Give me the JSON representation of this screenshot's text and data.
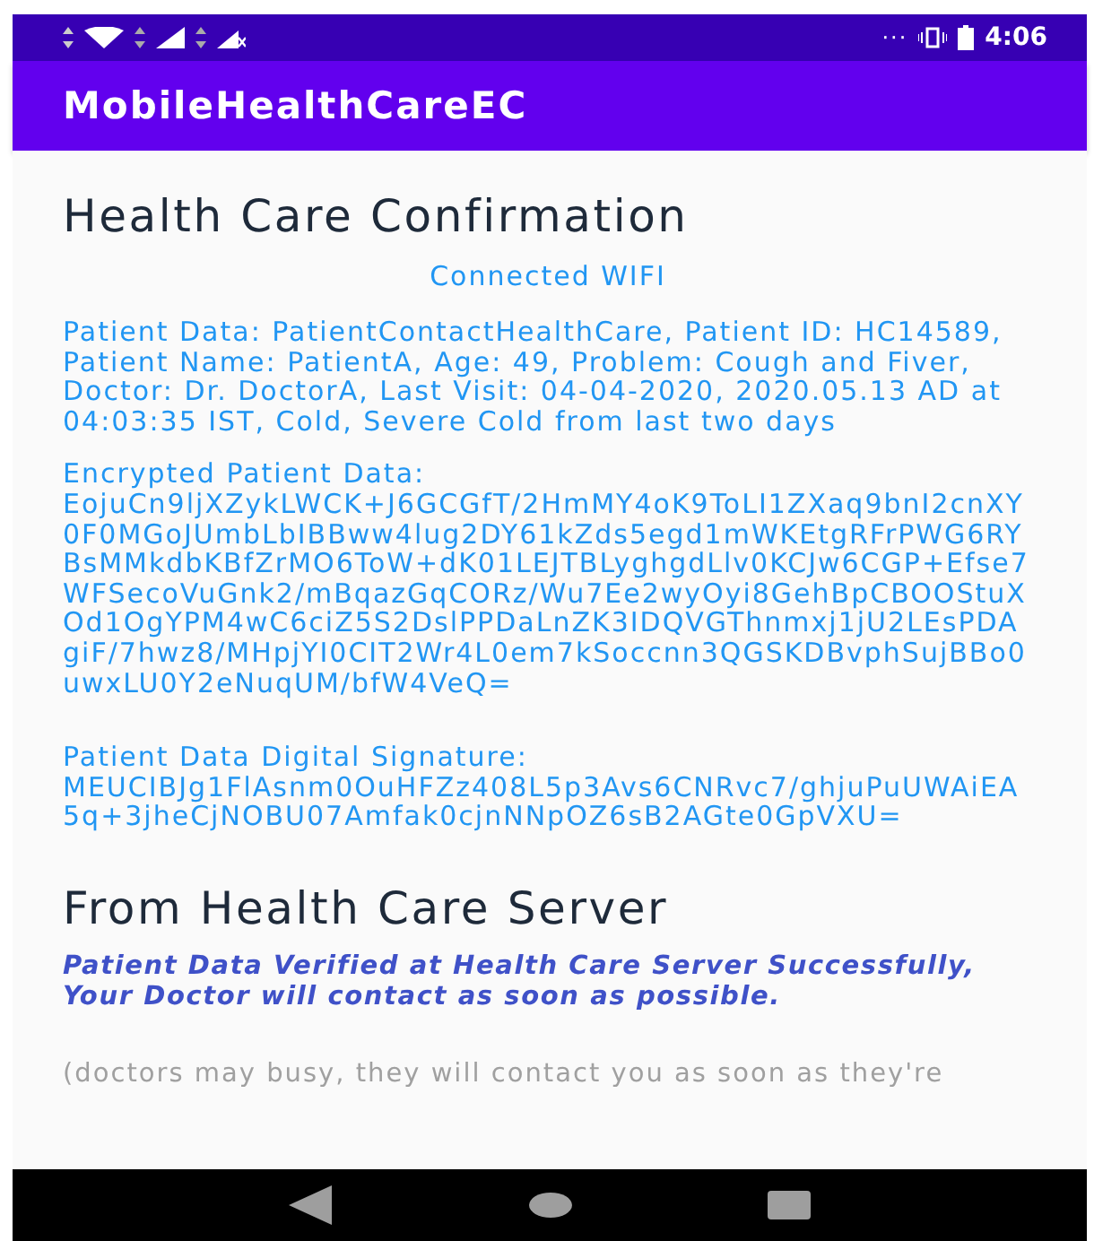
{
  "status_bar": {
    "time": "4:06",
    "notification_dots": "···"
  },
  "app_bar": {
    "title": "MobileHealthCareEC"
  },
  "content": {
    "title": "Health Care Confirmation",
    "connection": "Connected WIFI",
    "patient_data": "Patient Data: PatientContactHealthCare, Patient ID: HC14589, Patient Name: PatientA, Age: 49, Problem: Cough and Fiver, Doctor: Dr. DoctorA, Last Visit: 04-04-2020, 2020.05.13 AD at 04:03:35 IST, Cold, Severe Cold from last two days",
    "encrypted_label": "Encrypted Patient Data:",
    "encrypted_value": "EojuCn9ljXZykLWCK+J6GCGfT/2HmMY4oK9ToLI1ZXaq9bnI2cnXY0F0MGoJUmbLbIBBww4lug2DY61kZds5egd1mWKEtgRFrPWG6RYBsMMkdbKBfZrMO6ToW+dK01LEJTBLyghgdLlv0KCJw6CGP+Efse7WFSecoVuGnk2/mBqazGqCORz/Wu7Ee2wyOyi8GehBpCBOOStuXOd1OgYPM4wC6ciZ5S2DslPPDaLnZK3IDQVGThnmxj1jU2LEsPDAgiF/7hwz8/MHpjYI0CIT2Wr4L0em7kSoccnn3QGSKDBvphSujBBo0uwxLU0Y2eNuqUM/bfW4VeQ=",
    "signature_label": "Patient Data Digital Signature:",
    "signature_value": " MEUCIBJg1FlAsnm0OuHFZz408L5p3Avs6CNRvc7/ghjuPuUWAiEA5q+3jheCjNOBU07Amfak0cjnNNpOZ6sB2AGte0GpVXU=",
    "server_title": "From Health Care Server",
    "server_message": "Patient Data Verified at Health Care Server Successfully, Your Doctor will contact as soon as possible.",
    "server_note": "(doctors may busy, they will contact you as soon as they're"
  }
}
